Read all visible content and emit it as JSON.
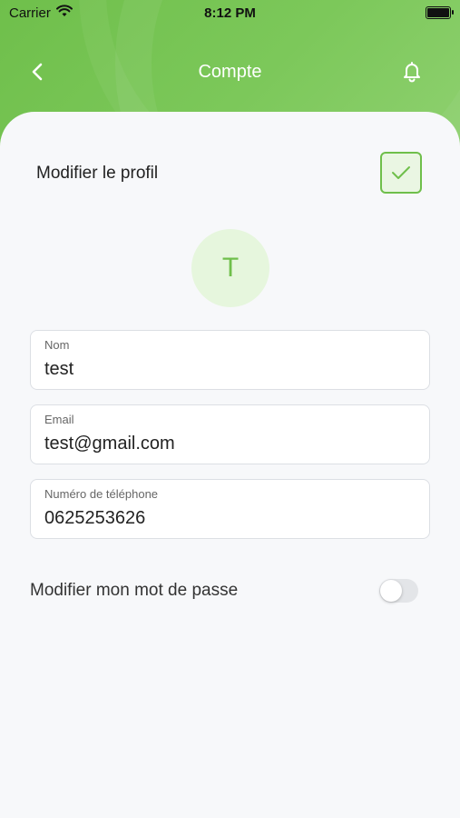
{
  "status_bar": {
    "carrier": "Carrier",
    "time": "8:12 PM"
  },
  "nav": {
    "title": "Compte"
  },
  "profile": {
    "edit_label": "Modifier le profil",
    "avatar_initial": "T"
  },
  "fields": [
    {
      "label": "Nom",
      "value": "test"
    },
    {
      "label": "Email",
      "value": "test@gmail.com"
    },
    {
      "label": "Numéro de téléphone",
      "value": "0625253626"
    }
  ],
  "password_toggle": {
    "label": "Modifier mon mot de passe",
    "on": false
  },
  "colors": {
    "accent": "#6fbf4b",
    "avatar_bg": "#e6f6dd",
    "background": "#f7f8fa"
  },
  "icons": {
    "back": "chevron-left-icon",
    "bell": "bell-icon",
    "check": "check-icon",
    "wifi": "wifi-icon",
    "battery": "battery-icon"
  }
}
